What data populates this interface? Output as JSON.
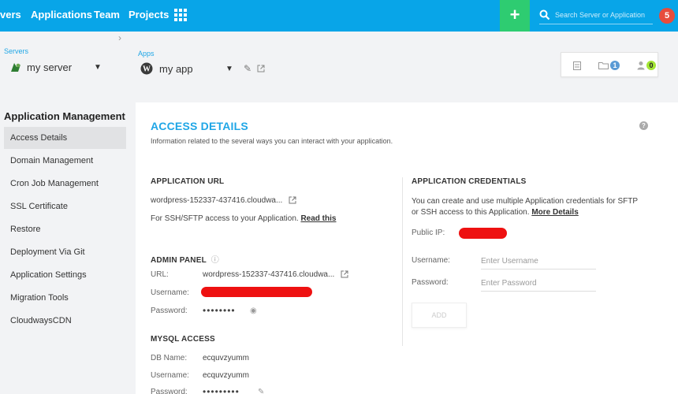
{
  "nav": {
    "items": [
      "vers",
      "Applications",
      "Team",
      "Projects"
    ],
    "add_label": "+",
    "search_placeholder": "Search Server or Application",
    "notification_count": "5"
  },
  "breadcrumb": {
    "servers_label": "Servers",
    "server_name": "my server",
    "apps_label": "Apps",
    "app_name": "my app"
  },
  "stats": {
    "folder_count": "1",
    "users_count": "0"
  },
  "sidebar": {
    "title": "Application Management",
    "items": [
      {
        "label": "Access Details"
      },
      {
        "label": "Domain Management"
      },
      {
        "label": "Cron Job Management"
      },
      {
        "label": "SSL Certificate"
      },
      {
        "label": "Restore"
      },
      {
        "label": "Deployment Via Git"
      },
      {
        "label": "Application Settings"
      },
      {
        "label": "Migration Tools"
      },
      {
        "label": "CloudwaysCDN"
      }
    ]
  },
  "main": {
    "title": "ACCESS DETAILS",
    "subtitle": "Information related to the several ways you can interact with your application.",
    "app_url": {
      "heading": "APPLICATION URL",
      "url": "wordpress-152337-437416.cloudwa...",
      "ssh_text": "For SSH/SFTP access to your Application.",
      "read_this": "Read this"
    },
    "admin_panel": {
      "heading": "ADMIN PANEL",
      "url_label": "URL:",
      "url": "wordpress-152337-437416.cloudwa...",
      "username_label": "Username:",
      "password_label": "Password:",
      "password_mask": "••••••••"
    },
    "mysql": {
      "heading": "MYSQL ACCESS",
      "db_name_label": "DB Name:",
      "db_name": "ecquvzyumm",
      "username_label": "Username:",
      "username": "ecquvzyumm",
      "password_label": "Password:",
      "password_mask": "•••••••••"
    },
    "credentials": {
      "heading": "APPLICATION CREDENTIALS",
      "desc_line1": "You can create and use multiple Application credentials for SFTP",
      "desc_line2": "or SSH access to this Application.",
      "more_details": "More Details",
      "public_ip_label": "Public IP:",
      "username_label": "Username:",
      "username_placeholder": "Enter Username",
      "password_label": "Password:",
      "password_placeholder": "Enter Password",
      "add_label": "ADD"
    }
  },
  "colors": {
    "nav_bg": "#08a5e8",
    "add_green": "#2ecc71",
    "notif_red": "#e74c3c",
    "accent_blue": "#1fa6e6",
    "redaction": "#ee1111"
  }
}
